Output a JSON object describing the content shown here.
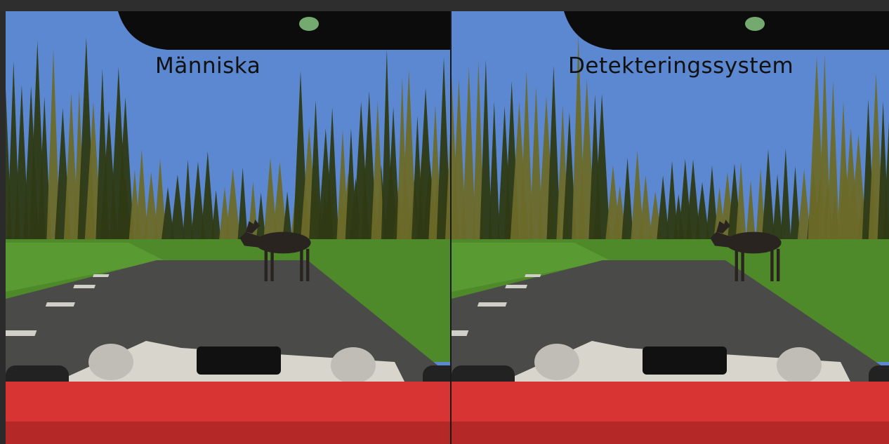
{
  "panels": [
    {
      "id": "left",
      "label": "Människa"
    },
    {
      "id": "right",
      "label": "Detekteringssystem"
    }
  ],
  "colors": {
    "sky": "#5b88d0",
    "tree_dark": "#2f3a14",
    "tree_light": "#6d6a28",
    "grass": "#4f8a2a",
    "road": "#4a4a48",
    "hood": "#d93434",
    "moose": "#2a2420",
    "mirror": "#0c0c0c"
  },
  "icons": [
    "moose-icon",
    "rearview-mirror-icon",
    "car-hood-icon"
  ]
}
